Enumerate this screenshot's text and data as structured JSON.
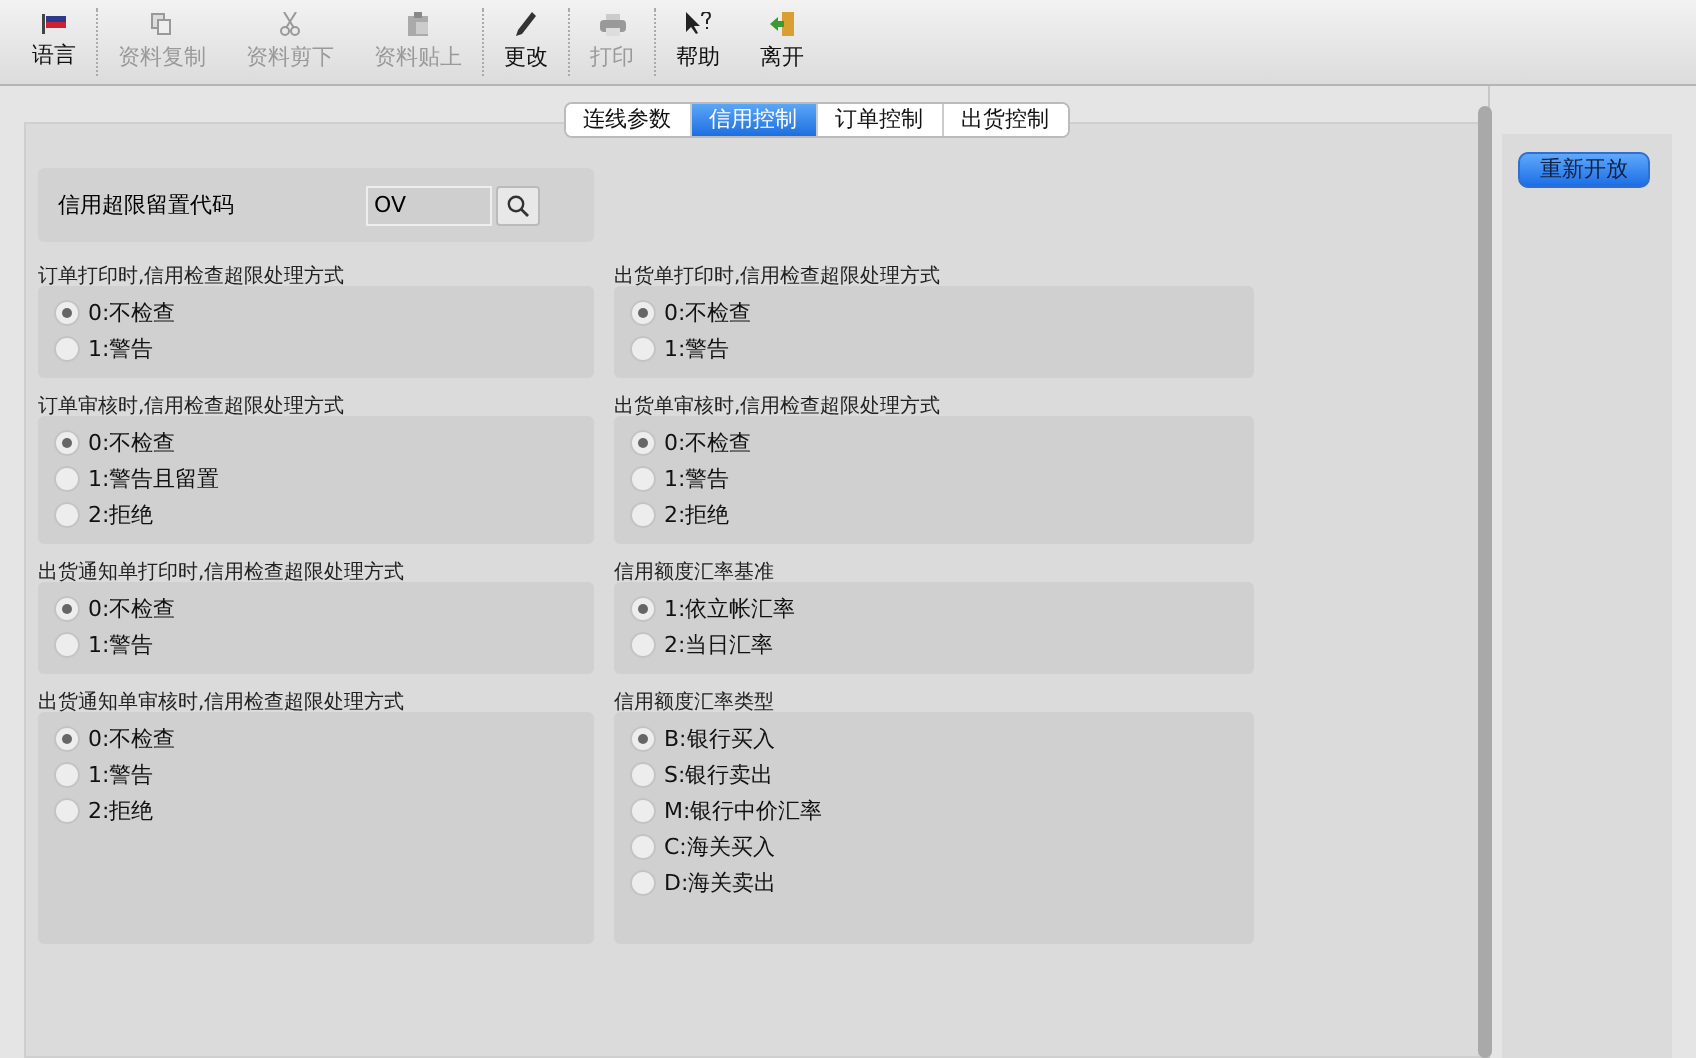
{
  "toolbar": [
    {
      "label": "语言",
      "disabled": false,
      "separator_after": true
    },
    {
      "label": "资料复制",
      "disabled": true,
      "separator_after": false
    },
    {
      "label": "资料剪下",
      "disabled": true,
      "separator_after": false
    },
    {
      "label": "资料贴上",
      "disabled": true,
      "separator_after": true
    },
    {
      "label": "更改",
      "disabled": false,
      "separator_after": true
    },
    {
      "label": "打印",
      "disabled": true,
      "separator_after": true
    },
    {
      "label": "帮助",
      "disabled": false,
      "separator_after": false
    },
    {
      "label": "离开",
      "disabled": false,
      "separator_after": false
    }
  ],
  "tabs": [
    {
      "label": "连线参数",
      "selected": false
    },
    {
      "label": "信用控制",
      "selected": true
    },
    {
      "label": "订单控制",
      "selected": false
    },
    {
      "label": "出货控制",
      "selected": false
    }
  ],
  "code_field": {
    "label": "信用超限留置代码",
    "value": "OV"
  },
  "groups": [
    {
      "title": "订单打印时,信用检查超限处理方式",
      "options": [
        {
          "label": "0:不检查",
          "selected": true
        },
        {
          "label": "1:警告",
          "selected": false
        }
      ]
    },
    {
      "title": "出货单打印时,信用检查超限处理方式",
      "options": [
        {
          "label": "0:不检查",
          "selected": true
        },
        {
          "label": "1:警告",
          "selected": false
        }
      ]
    },
    {
      "title": "订单审核时,信用检查超限处理方式",
      "options": [
        {
          "label": "0:不检查",
          "selected": true
        },
        {
          "label": "1:警告且留置",
          "selected": false
        },
        {
          "label": "2:拒绝",
          "selected": false
        }
      ]
    },
    {
      "title": "出货单审核时,信用检查超限处理方式",
      "options": [
        {
          "label": "0:不检查",
          "selected": true
        },
        {
          "label": "1:警告",
          "selected": false
        },
        {
          "label": "2:拒绝",
          "selected": false
        }
      ]
    },
    {
      "title": "出货通知单打印时,信用检查超限处理方式",
      "options": [
        {
          "label": "0:不检查",
          "selected": true
        },
        {
          "label": "1:警告",
          "selected": false
        }
      ]
    },
    {
      "title": "信用额度汇率基准",
      "options": [
        {
          "label": "1:依立帐汇率",
          "selected": true
        },
        {
          "label": "2:当日汇率",
          "selected": false
        }
      ]
    },
    {
      "title": "出货通知单审核时,信用检查超限处理方式",
      "options": [
        {
          "label": "0:不检查",
          "selected": true
        },
        {
          "label": "1:警告",
          "selected": false
        },
        {
          "label": "2:拒绝",
          "selected": false
        }
      ]
    },
    {
      "title": "信用额度汇率类型",
      "options": [
        {
          "label": "B:银行买入",
          "selected": true
        },
        {
          "label": "S:银行卖出",
          "selected": false
        },
        {
          "label": "M:银行中价汇率",
          "selected": false
        },
        {
          "label": "C:海关买入",
          "selected": false
        },
        {
          "label": "D:海关卖出",
          "selected": false
        }
      ]
    }
  ],
  "side_button": "重新开放"
}
